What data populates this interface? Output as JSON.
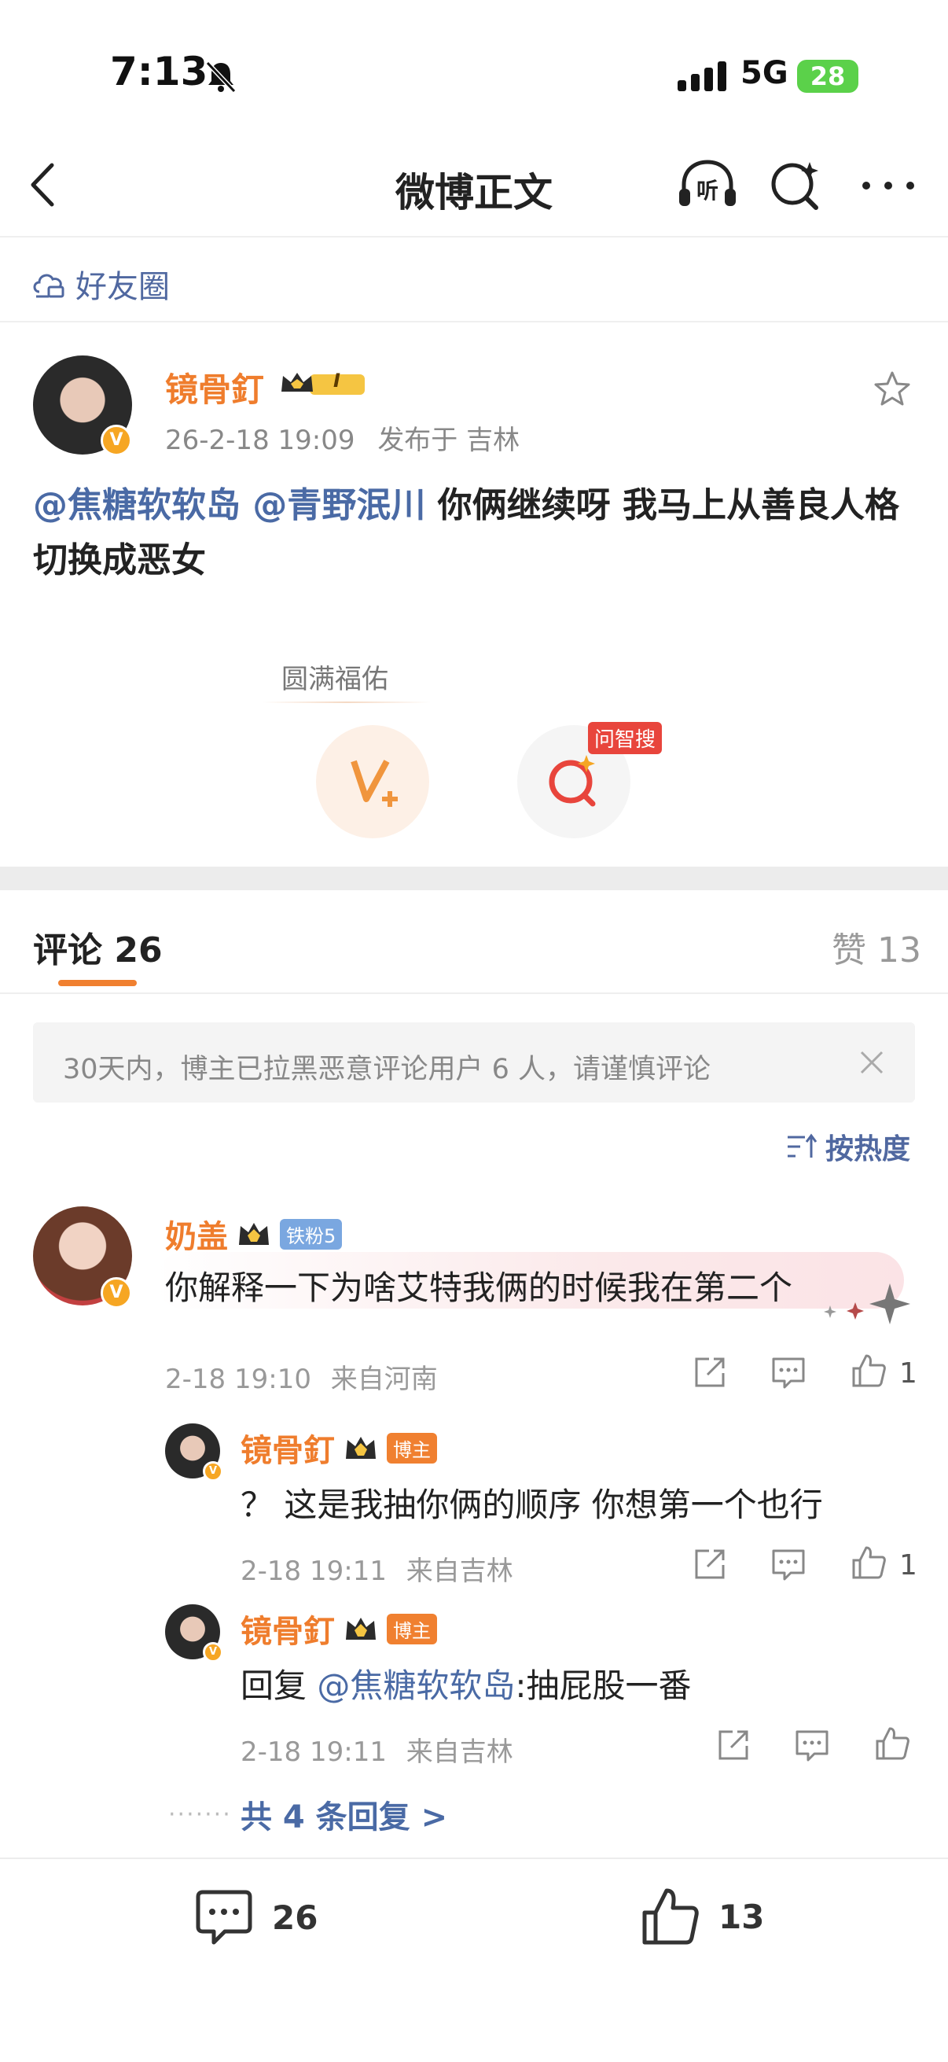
{
  "status_bar": {
    "time": "7:13",
    "network": "5G",
    "battery": "28"
  },
  "header": {
    "title": "微博正文"
  },
  "friends_circle": {
    "label": "好友圈"
  },
  "post": {
    "author": "镜骨釘",
    "date": "26-2-18 19:09",
    "location": "发布于 吉林",
    "mention1": "@焦糖软软岛",
    "mention2": "@青野泯川",
    "text": "你俩继续呀 我马上从善良人格切换成恶女",
    "blessing_label": "圆满福佑",
    "ai_search_badge": "问智搜",
    "level_badge": "I"
  },
  "tabs": {
    "comments_label": "评论",
    "comments_count": "26",
    "likes_label": "赞",
    "likes_count": "13"
  },
  "notice": {
    "text": "30天内，博主已拉黑恶意评论用户 6 人，请谨慎评论"
  },
  "sort": {
    "label": "按热度"
  },
  "comment": {
    "author": "奶盖",
    "fan_badge": "铁粉5",
    "text": "你解释一下为啥艾特我俩的时候我在第二个",
    "time": "2-18 19:10",
    "from": "来自河南",
    "likes": "1"
  },
  "replies": [
    {
      "author": "镜骨釘",
      "badge": "博主",
      "text": "？ 这是我抽你俩的顺序 你想第一个也行",
      "time": "2-18 19:11",
      "from": "来自吉林",
      "likes": "1"
    },
    {
      "author": "镜骨釘",
      "badge": "博主",
      "prefix": "回复 ",
      "mention": "@焦糖软软岛",
      "suffix": ":抽屁股一番",
      "time": "2-18 19:11",
      "from": "来自吉林"
    }
  ],
  "more_replies": {
    "label": "共 4 条回复 >"
  },
  "bottom": {
    "comments": "26",
    "likes": "13"
  },
  "colors": {
    "accent": "#f08030",
    "link": "#4a6aa5",
    "username": "#ef7d2d"
  }
}
